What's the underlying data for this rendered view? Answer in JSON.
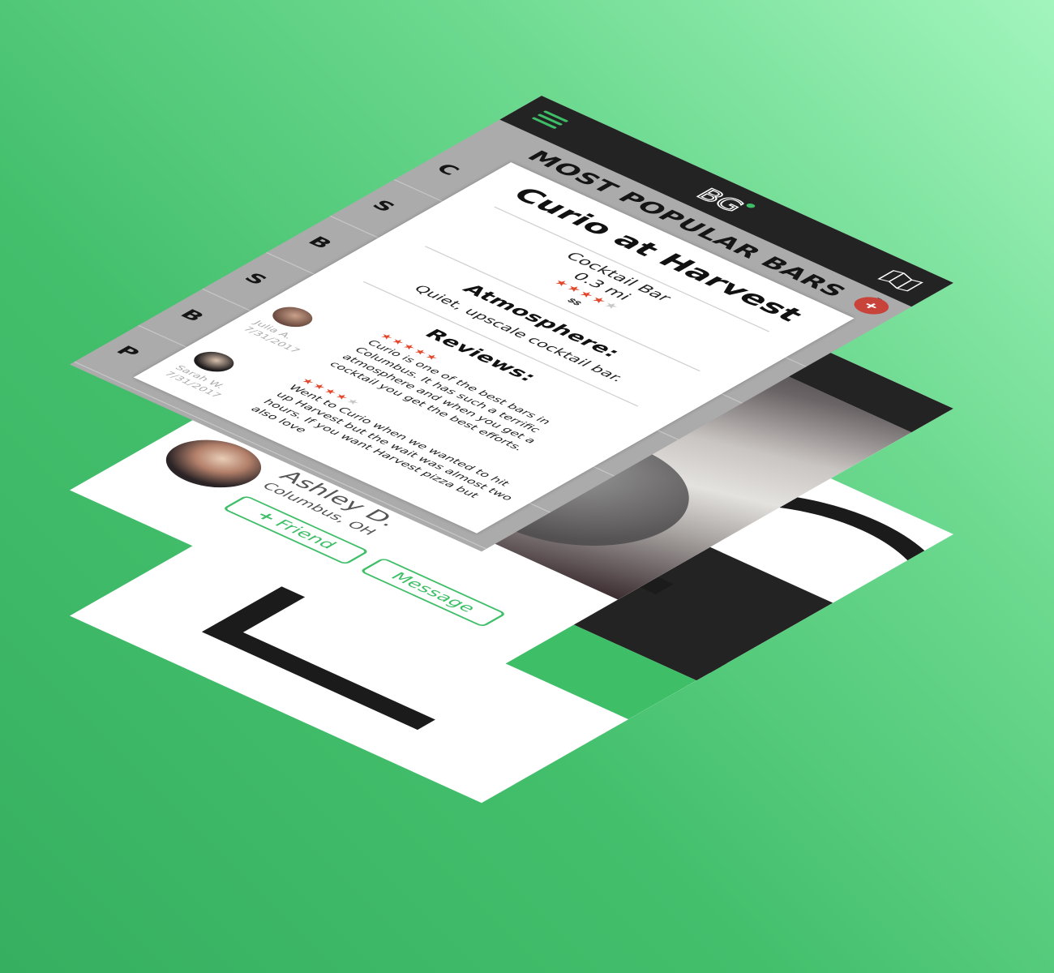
{
  "colors": {
    "background_light": "#a2f5bd",
    "background_dark": "#36b060",
    "accent_green": "#3fbe68",
    "topbar": "#232323",
    "list_background": "#ababab",
    "star": "#e3482c",
    "fab": "#c8443b"
  },
  "splash": {
    "logo_icon": "bg-logo-large"
  },
  "profile": {
    "menu_icon": "hamburger-menu-icon",
    "name": "Ashley D.",
    "location": "Columbus, OH",
    "friend_plus": "+",
    "friend_label": "Friend",
    "message_label": "Message"
  },
  "list": {
    "menu_icon": "hamburger-menu-icon",
    "logo_text": "BG",
    "map_icon": "open-map-icon",
    "title": "MOST POPULAR BARS",
    "rows": [
      {
        "letter": "C"
      },
      {
        "letter": "S"
      },
      {
        "letter": "B"
      },
      {
        "letter": "S"
      },
      {
        "letter": "B"
      },
      {
        "letter": "P"
      }
    ],
    "fab_label": "+"
  },
  "popup": {
    "name": "Curio at Harvest",
    "type": "Cocktail Bar",
    "distance": "0.3 mi",
    "rating": 4,
    "rating_max": 5,
    "price": "$$",
    "atmosphere_heading": "Atmosphere:",
    "atmosphere_text": "Quiet, upscale cocktail bar.",
    "reviews_heading": "Reviews:",
    "reviews": [
      {
        "author": "Julia A.",
        "date": "7/31/2017",
        "rating": 5,
        "stars_on": "★★★★★",
        "stars_off": "",
        "text": "Curio is one of the best bars in Columbus. It has such a terrific atmosphere and when you get a cocktail you get the best efforts."
      },
      {
        "author": "Sarah W.",
        "date": "7/31/2017",
        "rating": 4,
        "stars_on": "★★★★",
        "stars_off": "★",
        "text": "Went to Curio when we wanted to hit up Harvest but the wait was almost two hours. If you want Harvest pizza but also love"
      }
    ],
    "stars_on": "★★★★",
    "stars_off": "★"
  }
}
